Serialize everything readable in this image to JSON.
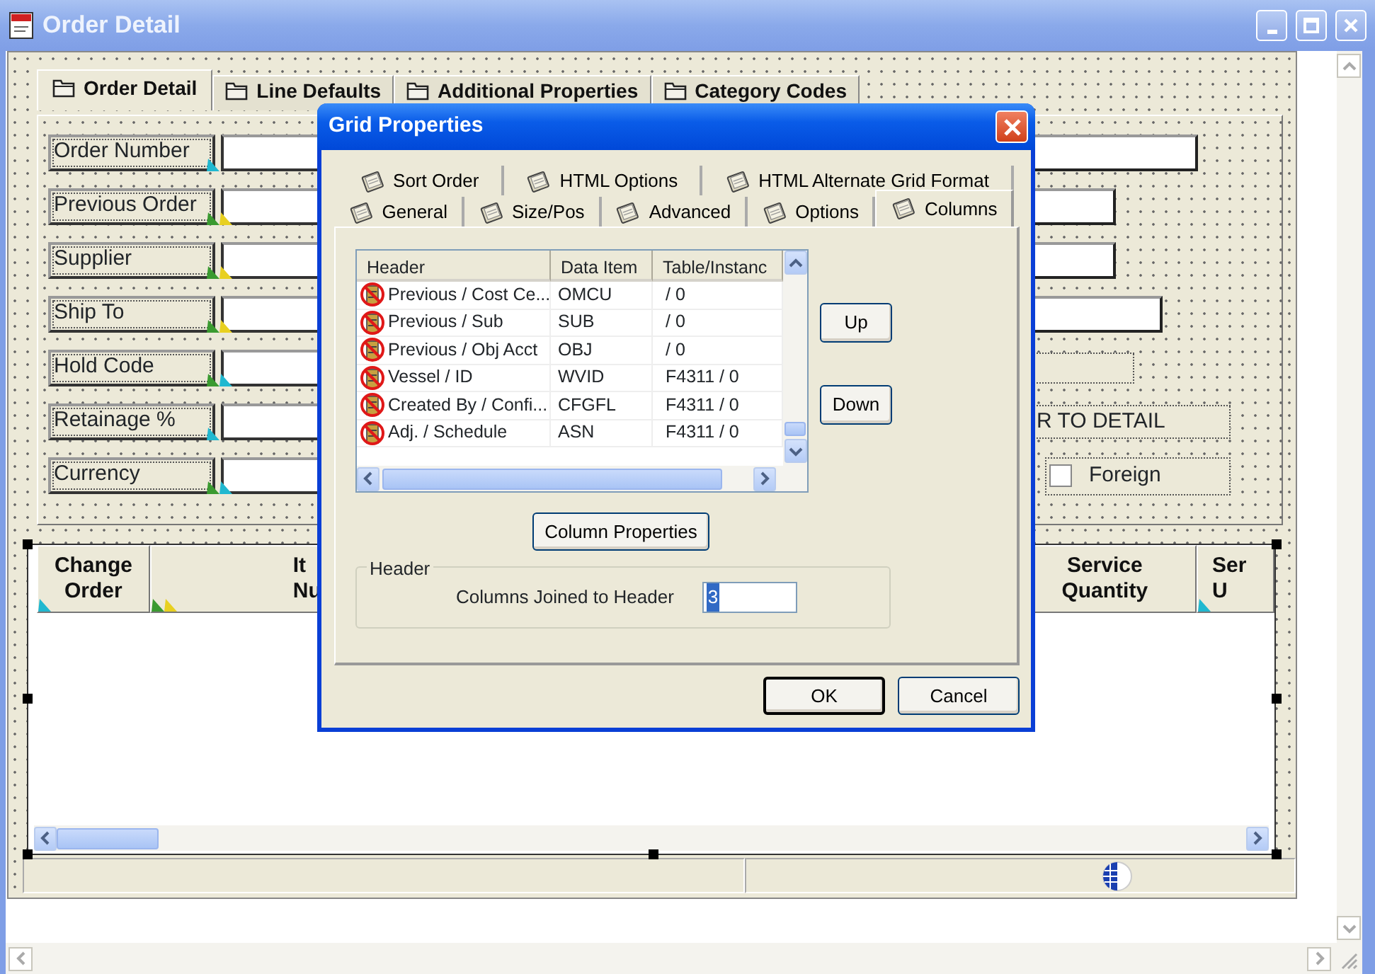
{
  "window": {
    "title": "Order Detail"
  },
  "form_tabs": [
    {
      "label": "Order Detail",
      "selected": true
    },
    {
      "label": "Line Defaults",
      "selected": false
    },
    {
      "label": "Additional Properties",
      "selected": false
    },
    {
      "label": "Category Codes",
      "selected": false
    }
  ],
  "fields": [
    {
      "label": "Order Number",
      "marks": [
        {
          "color": "#20b8d0"
        }
      ]
    },
    {
      "label": "Previous Order",
      "marks": [
        {
          "color": "#3a9a30"
        },
        {
          "color": "#e8d020"
        }
      ]
    },
    {
      "label": "Supplier",
      "marks": [
        {
          "color": "#3a9a30"
        },
        {
          "color": "#e8d020"
        }
      ]
    },
    {
      "label": "Ship To",
      "marks": [
        {
          "color": "#3a9a30"
        },
        {
          "color": "#e8d020"
        }
      ]
    },
    {
      "label": "Hold Code",
      "marks": [
        {
          "color": "#3a9a30"
        },
        {
          "color": "#20b8d0"
        }
      ]
    },
    {
      "label": "Retainage %",
      "marks": [
        {
          "color": "#20b8d0"
        }
      ]
    },
    {
      "label": "Currency",
      "marks": [
        {
          "color": "#3a9a30"
        },
        {
          "color": "#20b8d0"
        }
      ]
    }
  ],
  "right_controls": [
    {
      "kind": "field"
    },
    {
      "kind": "field"
    },
    {
      "kind": "field"
    },
    {
      "kind": "field"
    },
    {
      "kind": "dotted_field"
    },
    {
      "kind": "label_box",
      "text": "R TO DETAIL"
    },
    {
      "kind": "checkbox",
      "label": "Foreign",
      "checked": false
    }
  ],
  "grid": {
    "columns": [
      {
        "lines": [
          "Change",
          "Order"
        ],
        "marks": [
          {
            "color": "#20b8d0"
          }
        ]
      },
      {
        "lines": [
          "It",
          "Nu"
        ],
        "marks": [
          {
            "color": "#3a9a30"
          },
          {
            "color": "#e8d020"
          }
        ]
      },
      {
        "lines": [
          "Service",
          "Quantity"
        ]
      },
      {
        "lines": [
          "Ser",
          "U"
        ],
        "marks": [
          {
            "color": "#20b8d0"
          }
        ]
      }
    ]
  },
  "dialog": {
    "title": "Grid Properties",
    "tab_rows": [
      [
        {
          "label": "Sort Order",
          "selected": false
        },
        {
          "label": "HTML Options",
          "selected": false
        },
        {
          "label": "HTML Alternate Grid Format",
          "selected": false
        }
      ],
      [
        {
          "label": "General",
          "selected": false
        },
        {
          "label": "Size/Pos",
          "selected": false
        },
        {
          "label": "Advanced",
          "selected": false
        },
        {
          "label": "Options",
          "selected": false
        },
        {
          "label": "Columns",
          "selected": true
        }
      ]
    ],
    "list": {
      "columns": [
        "Header",
        "Data Item",
        "Table/Instanc"
      ],
      "rows": [
        {
          "header": "Previous / Cost Ce...",
          "data_item": "OMCU",
          "table": "/ 0"
        },
        {
          "header": "Previous / Sub",
          "data_item": "SUB",
          "table": "/ 0"
        },
        {
          "header": "Previous / Obj Acct",
          "data_item": "OBJ",
          "table": "/ 0"
        },
        {
          "header": "Vessel / ID",
          "data_item": "WVID",
          "table": "F4311 / 0"
        },
        {
          "header": "Created By / Confi...",
          "data_item": "CFGFL",
          "table": "F4311 / 0"
        },
        {
          "header": "Adj. / Schedule",
          "data_item": "ASN",
          "table": "F4311 / 0"
        }
      ]
    },
    "side_buttons": [
      "Up",
      "Down"
    ],
    "properties_button": "Column Properties",
    "group": {
      "title": "Header",
      "label": "Columns Joined to Header",
      "value": "3",
      "value_selected": true
    },
    "buttons": [
      {
        "label": "OK",
        "default": true
      },
      {
        "label": "Cancel",
        "default": false
      }
    ]
  }
}
